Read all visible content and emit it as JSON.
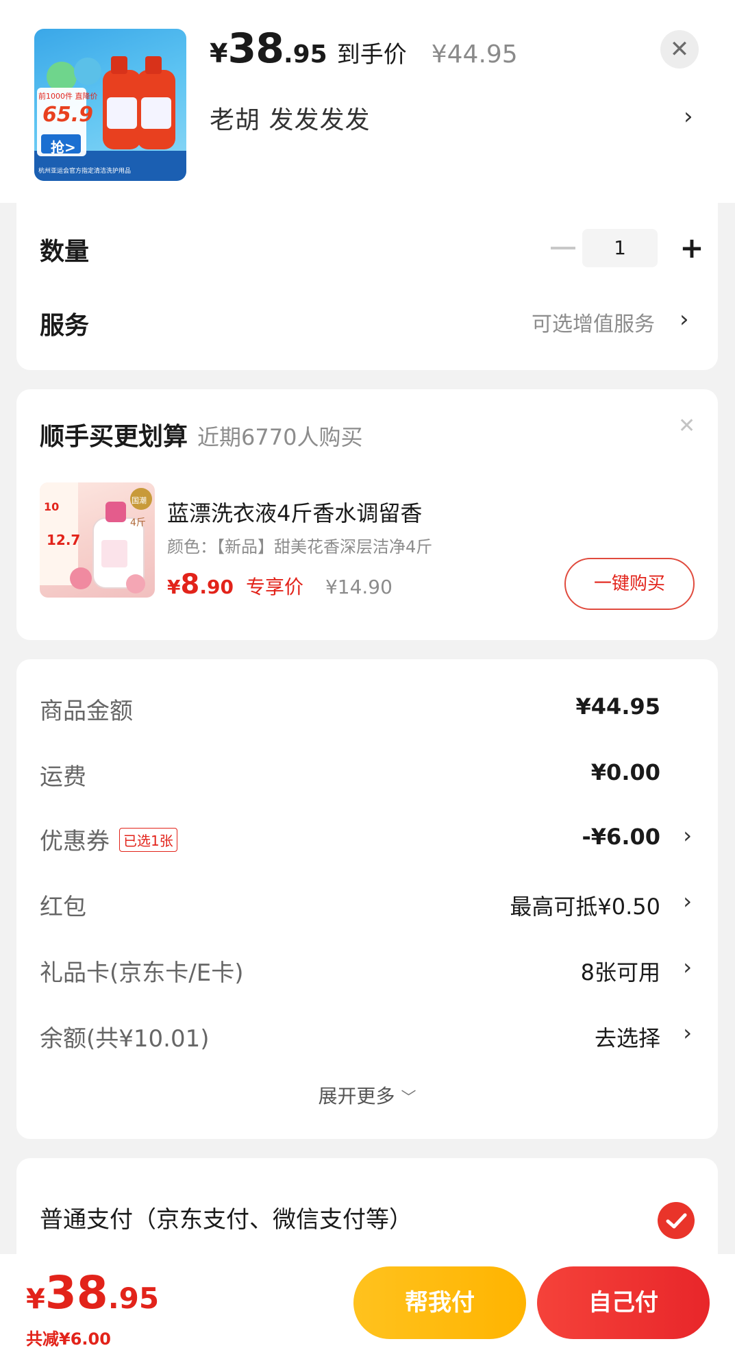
{
  "header": {
    "currency": "¥",
    "price_int": "38",
    "price_dec": ".95",
    "price_tag": "到手价",
    "original_price": "¥44.95",
    "spec": "老胡  发发发发",
    "thumb_texts": {
      "badge_top": "前1000件  直降价",
      "badge_price": "65.9",
      "grab": "抢>",
      "footer": "杭州亚运会官方指定清洁洗护用品"
    }
  },
  "options": {
    "quantity_label": "数量",
    "quantity_value": "1",
    "service_label": "服务",
    "service_value": "可选增值服务"
  },
  "upsell": {
    "title": "顺手买更划算",
    "subtitle": "近期6770人购买",
    "product_name": "蓝漂洗衣液4斤香水调留香",
    "product_spec": "颜色：【新品】甜美花香深层洁净4斤",
    "price_sym": "¥",
    "price_int": "8",
    "price_dec": ".90",
    "price_tag": "专享价",
    "original_price": "¥14.90",
    "buy_button": "一键购买",
    "image_texts": {
      "price_a": "10",
      "price_b": "12.7",
      "weight": "4斤",
      "badge": "国潮"
    }
  },
  "fees": {
    "rows": [
      {
        "label": "商品金额",
        "value": "¥44.95"
      },
      {
        "label": "运费",
        "value": "¥0.00"
      },
      {
        "label": "优惠券",
        "badge": "已选1张",
        "value": "-¥6.00"
      },
      {
        "label": "红包",
        "value": "最高可抵¥0.50"
      },
      {
        "label": "礼品卡(京东卡/E卡)",
        "value": "8张可用"
      },
      {
        "label": "余额(共¥10.01)",
        "value": "去选择"
      }
    ],
    "expand": "展开更多"
  },
  "payment": {
    "method": "普通支付（京东支付、微信支付等）"
  },
  "bottom": {
    "currency": "¥",
    "total_int": "38",
    "total_dec": ".95",
    "discount": "共减¥6.00",
    "help_pay": "帮我付",
    "self_pay": "自己付"
  },
  "icons": {
    "close": "close-icon",
    "chevron": "chevron-right-icon",
    "minus": "minus-icon",
    "plus": "plus-icon",
    "check": "check-icon"
  },
  "colors": {
    "accent_red": "#e2231a",
    "pay_red": "#e8262a",
    "help_yellow": "#ffb400"
  }
}
